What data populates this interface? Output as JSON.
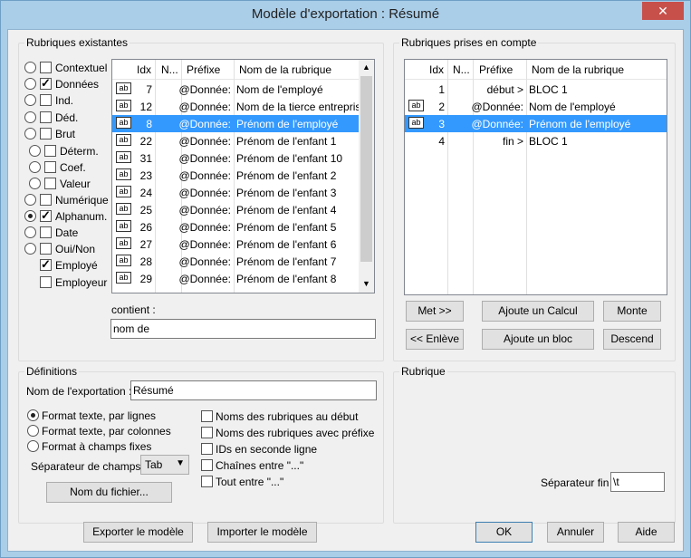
{
  "window": {
    "title": "Modèle d'exportation : Résumé",
    "close_glyph": "✕"
  },
  "left": {
    "group_label": "Rubriques existantes",
    "filters": [
      {
        "label": "Contextuel",
        "radio": false,
        "checked": false
      },
      {
        "label": "Données",
        "radio": false,
        "checked": true
      },
      {
        "label": "Ind.",
        "radio": false,
        "checked": false
      },
      {
        "label": "Déd.",
        "radio": false,
        "checked": false
      },
      {
        "label": "Brut",
        "radio": false,
        "checked": false
      },
      {
        "label": "Déterm.",
        "radio": false,
        "checked": false
      },
      {
        "label": "Coef.",
        "radio": false,
        "checked": false
      },
      {
        "label": "Valeur",
        "radio": false,
        "checked": false
      },
      {
        "label": "Numérique",
        "radio": false,
        "checked": false
      },
      {
        "label": "Alphanum.",
        "radio": true,
        "checked": true
      },
      {
        "label": "Date",
        "radio": false,
        "checked": false
      },
      {
        "label": "Oui/Non",
        "radio": false,
        "checked": false
      },
      {
        "label": "Employé",
        "radio": null,
        "checked": true
      },
      {
        "label": "Employeur",
        "radio": null,
        "checked": false
      }
    ],
    "columns": {
      "idx": "Idx",
      "n": "N...",
      "prefix": "Préfixe",
      "name": "Nom de la rubrique"
    },
    "rows": [
      {
        "idx": "7",
        "prefix": "@Donnée:",
        "name": "Nom de l'employé",
        "icon": "ab",
        "selected": false
      },
      {
        "idx": "12",
        "prefix": "@Donnée:",
        "name": "Nom de la tierce entreprise",
        "icon": "ab",
        "selected": false
      },
      {
        "idx": "8",
        "prefix": "@Donnée:",
        "name": "Prénom de l'employé",
        "icon": "ab",
        "selected": true
      },
      {
        "idx": "22",
        "prefix": "@Donnée:",
        "name": "Prénom de l'enfant 1",
        "icon": "ab",
        "selected": false
      },
      {
        "idx": "31",
        "prefix": "@Donnée:",
        "name": "Prénom de l'enfant 10",
        "icon": "ab",
        "selected": false
      },
      {
        "idx": "23",
        "prefix": "@Donnée:",
        "name": "Prénom de l'enfant 2",
        "icon": "ab",
        "selected": false
      },
      {
        "idx": "24",
        "prefix": "@Donnée:",
        "name": "Prénom de l'enfant 3",
        "icon": "ab",
        "selected": false
      },
      {
        "idx": "25",
        "prefix": "@Donnée:",
        "name": "Prénom de l'enfant 4",
        "icon": "ab",
        "selected": false
      },
      {
        "idx": "26",
        "prefix": "@Donnée:",
        "name": "Prénom de l'enfant 5",
        "icon": "ab",
        "selected": false
      },
      {
        "idx": "27",
        "prefix": "@Donnée:",
        "name": "Prénom de l'enfant 6",
        "icon": "ab",
        "selected": false
      },
      {
        "idx": "28",
        "prefix": "@Donnée:",
        "name": "Prénom de l'enfant 7",
        "icon": "ab",
        "selected": false
      },
      {
        "idx": "29",
        "prefix": "@Donnée:",
        "name": "Prénom de l'enfant 8",
        "icon": "ab",
        "selected": false
      }
    ],
    "contains_label": "contient :",
    "contains_value": "nom de"
  },
  "right": {
    "group_label": "Rubriques prises en compte",
    "columns": {
      "idx": "Idx",
      "n": "N...",
      "prefix": "Préfixe",
      "name": "Nom de la rubrique"
    },
    "rows": [
      {
        "idx": "1",
        "prefix": "début >",
        "name": "BLOC 1",
        "icon": "",
        "selected": false
      },
      {
        "idx": "2",
        "prefix": "@Donnée:",
        "name": "Nom de l'employé",
        "icon": "ab",
        "selected": false
      },
      {
        "idx": "3",
        "prefix": "@Donnée:",
        "name": "Prénom de l'employé",
        "icon": "ab",
        "selected": true
      },
      {
        "idx": "4",
        "prefix": "fin >",
        "name": "BLOC 1",
        "icon": "",
        "selected": false
      }
    ],
    "buttons": {
      "met": "Met >>",
      "ajoute_calcul": "Ajoute un Calcul",
      "monte": "Monte",
      "enleve": "<< Enlève",
      "ajoute_bloc": "Ajoute un bloc",
      "descend": "Descend"
    }
  },
  "definitions": {
    "group_label": "Définitions",
    "name_label": "Nom de l'exportation :",
    "name_value": "Résumé",
    "formats": [
      {
        "label": "Format texte, par lignes",
        "selected": true
      },
      {
        "label": "Format texte, par colonnes",
        "selected": false
      },
      {
        "label": "Format à champs fixes",
        "selected": false
      }
    ],
    "options": [
      {
        "label": "Noms des rubriques au début",
        "checked": false
      },
      {
        "label": "Noms des rubriques avec préfixe",
        "checked": false
      },
      {
        "label": "IDs en seconde ligne",
        "checked": false
      },
      {
        "label": "Chaînes entre \"...\"",
        "checked": false
      },
      {
        "label": "Tout entre \"...\"",
        "checked": false
      }
    ],
    "separator_label": "Séparateur de champs :",
    "separator_value": "Tab",
    "file_button": "Nom du fichier..."
  },
  "rubrique": {
    "group_label": "Rubrique",
    "end_separator_label": "Séparateur fin :",
    "end_separator_value": "\\t"
  },
  "footer": {
    "export": "Exporter le modèle",
    "import": "Importer le modèle",
    "ok": "OK",
    "cancel": "Annuler",
    "help": "Aide"
  }
}
